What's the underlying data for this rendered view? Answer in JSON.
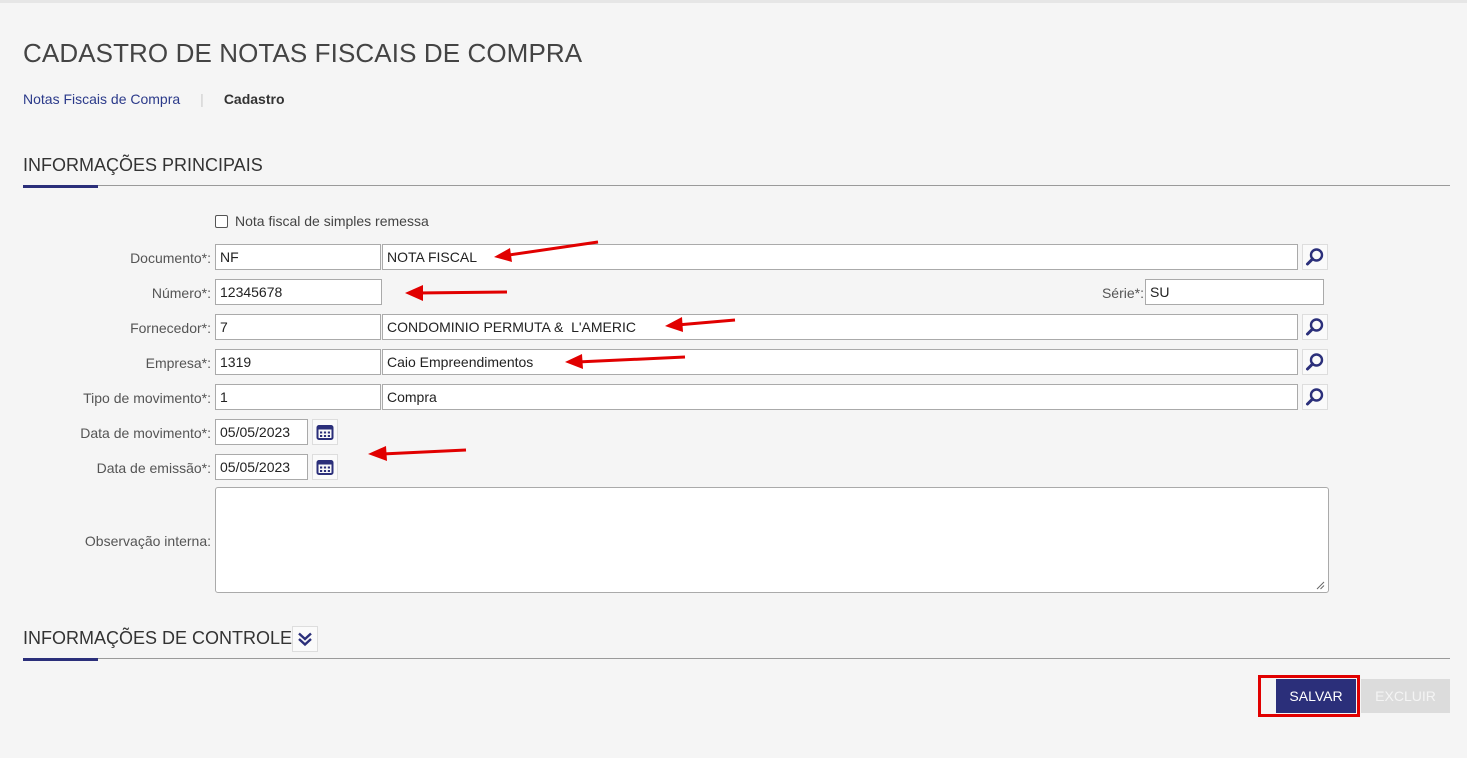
{
  "page": {
    "title": "CADASTRO DE NOTAS FISCAIS DE COMPRA"
  },
  "breadcrumb": {
    "parent": "Notas Fiscais de Compra",
    "current": "Cadastro"
  },
  "sections": {
    "main": "INFORMAÇÕES PRINCIPAIS",
    "control": "INFORMAÇÕES DE CONTROLE"
  },
  "form": {
    "simples_remessa": {
      "label": "Nota fiscal de simples remessa",
      "checked": false
    },
    "documento": {
      "label": "Documento*:",
      "code": "NF",
      "description": "NOTA FISCAL"
    },
    "numero": {
      "label": "Número*:",
      "value": "12345678"
    },
    "serie": {
      "label": "Série*:",
      "value": "SU"
    },
    "fornecedor": {
      "label": "Fornecedor*:",
      "code": "7",
      "description": "CONDOMINIO PERMUTA &  L'AMERIC"
    },
    "empresa": {
      "label": "Empresa*:",
      "code": "1319",
      "description": "Caio Empreendimentos"
    },
    "tipo_movimento": {
      "label": "Tipo de movimento*:",
      "code": "1",
      "description": "Compra"
    },
    "data_movimento": {
      "label": "Data de movimento*:",
      "value": "05/05/2023"
    },
    "data_emissao": {
      "label": "Data de emissão*:",
      "value": "05/05/2023"
    },
    "observacao": {
      "label": "Observação interna:",
      "value": ""
    }
  },
  "buttons": {
    "save": "SALVAR",
    "delete": "EXCLUIR"
  },
  "icons": {
    "lookup": "search-icon",
    "calendar": "calendar-icon",
    "collapse": "double-chevron-down-icon"
  },
  "colors": {
    "accent": "#2b2f7a",
    "annotation": "#e10000"
  }
}
